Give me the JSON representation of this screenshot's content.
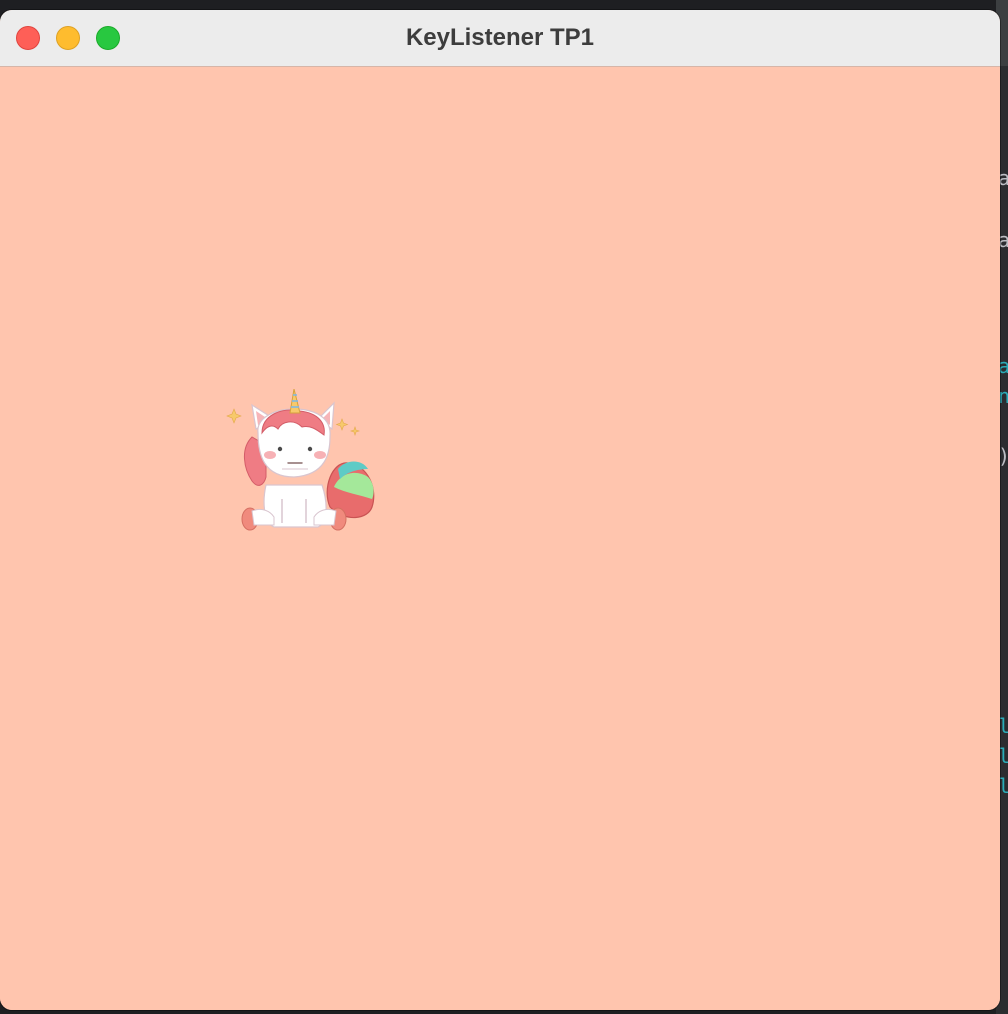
{
  "window": {
    "title": "KeyListener TP1",
    "background_color": "#ffc5ae",
    "buttons": {
      "close": "close-button",
      "minimize": "minimize-button",
      "zoom": "zoom-button"
    }
  },
  "sprite": {
    "icon": "unicorn-icon"
  },
  "background_editor": {
    "glyphs": [
      "a",
      "a",
      "a",
      "n",
      ")",
      "l",
      "l",
      "l"
    ]
  }
}
